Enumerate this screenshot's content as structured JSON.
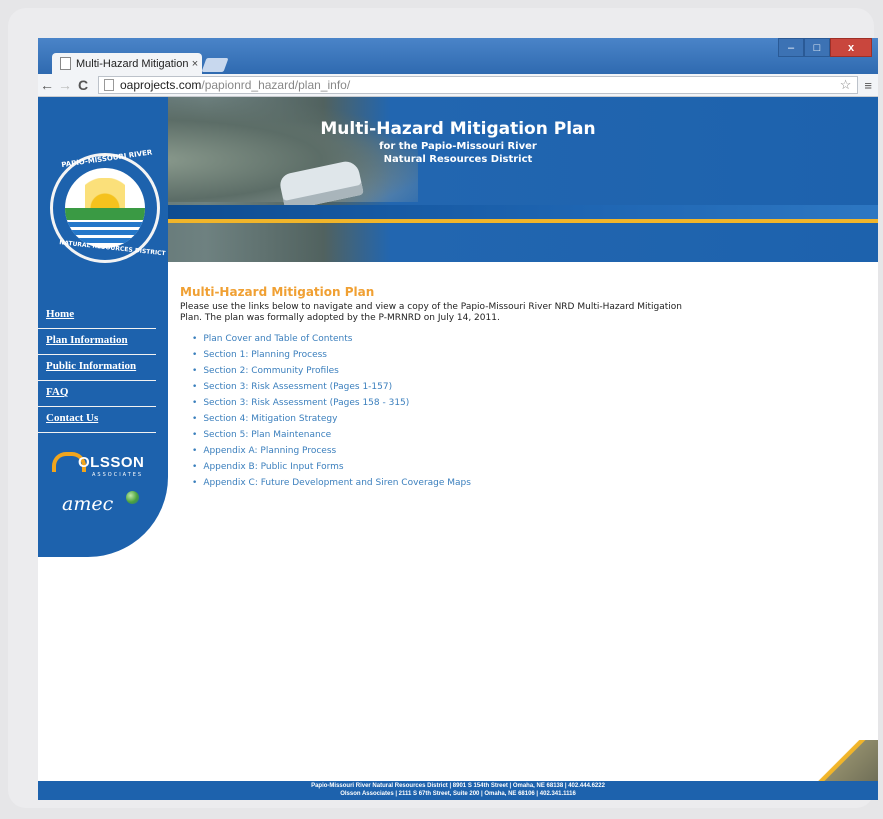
{
  "browser": {
    "tab_title": "Multi-Hazard Mitigation P",
    "tab_close": "×",
    "url_host": "oaprojects.com",
    "url_path": "/papionrd_hazard/plan_info/",
    "back_icon": "←",
    "forward_icon": "→",
    "reload_icon": "C",
    "star_icon": "☆",
    "menu_icon": "≡",
    "min_icon": "–",
    "max_icon": "□",
    "close_icon": "x"
  },
  "banner": {
    "title": "Multi-Hazard Mitigation Plan",
    "subtitle1": "for the Papio-Missouri River",
    "subtitle2": "Natural Resources District"
  },
  "seal": {
    "top_text": "PAPIO-MISSOURI RIVER",
    "bottom_text": "NATURAL RESOURCES DISTRICT"
  },
  "sidebar": {
    "items": [
      {
        "label": "Home"
      },
      {
        "label": "Plan Information"
      },
      {
        "label": "Public Information"
      },
      {
        "label": "FAQ"
      },
      {
        "label": "Contact Us"
      }
    ],
    "olsson_name": "OLSSON",
    "olsson_sub": "ASSOCIATES",
    "amec_name": "amec"
  },
  "content": {
    "heading": "Multi-Hazard Mitigation Plan",
    "intro": "Please use the links below to navigate and view a copy of the Papio-Missouri River NRD Multi-Hazard Mitigation Plan. The plan was formally adopted by the P-MRNRD on July 14, 2011.",
    "links": [
      "Plan Cover and Table of Contents",
      "Section 1: Planning Process",
      "Section 2: Community Profiles",
      "Section 3: Risk Assessment (Pages 1-157)",
      "Section 3: Risk Assessment (Pages 158 - 315)",
      "Section 4: Mitigation Strategy",
      "Section 5: Plan Maintenance",
      "Appendix A: Planning Process",
      "Appendix B: Public Input Forms",
      "Appendix C: Future Development and Siren Coverage Maps"
    ]
  },
  "footer": {
    "line1": "Papio-Missouri River Natural Resources District | 8901 S 154th Street | Omaha, NE 68138 | 402.444.6222",
    "line2": "Olsson Associates | 2111 S 67th Street, Suite 200 | Omaha, NE 68106 | 402.341.1116"
  }
}
